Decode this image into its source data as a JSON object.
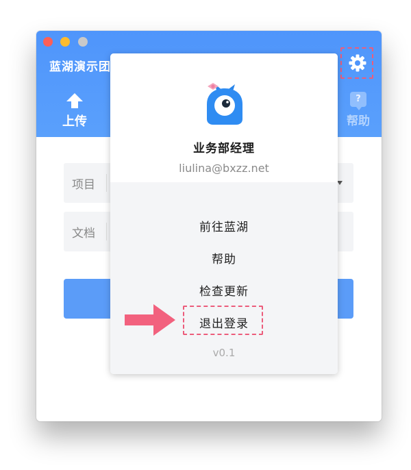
{
  "app": {
    "title": "蓝湖演示团"
  },
  "toolbar": {
    "upload_label": "上传",
    "help_label": "帮助",
    "help_icon_glyph": "?",
    "settings_icon": "gear-icon"
  },
  "form": {
    "project_label": "项目",
    "document_label": "文档"
  },
  "popup": {
    "user_name": "业务部经理",
    "user_email": "liulina@bxzz.net",
    "menu": [
      {
        "label": "前往蓝湖"
      },
      {
        "label": "帮助"
      },
      {
        "label": "检查更新"
      },
      {
        "label": "退出登录"
      }
    ],
    "version": "v0.1"
  },
  "colors": {
    "brand_blue": "#4f95fb",
    "highlight_pink": "#ec5c7b",
    "arrow_pink": "#f2617e"
  }
}
